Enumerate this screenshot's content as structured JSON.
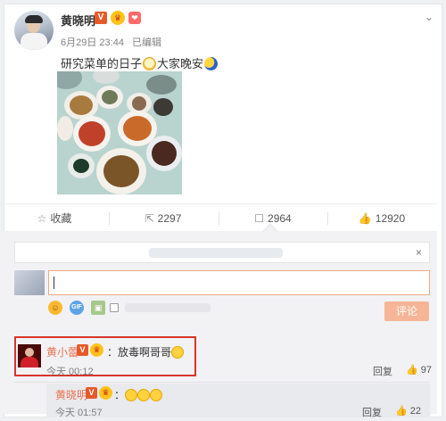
{
  "post": {
    "author": "黄晓明",
    "verified_badge": "V",
    "date": "6月29日 23:44",
    "edited": "已编辑",
    "text_before_emoji": "研究菜单的日子",
    "text_after_emoji": "大家晚安",
    "menu_icon": "chevron-down-icon"
  },
  "actions": {
    "favorite_label": "收藏",
    "repost_count": "2297",
    "comment_count": "2964",
    "like_count": "12920"
  },
  "composer": {
    "submit_label": "评论",
    "close_label": "×",
    "tools": [
      "smile-icon",
      "gif-icon",
      "image-icon",
      "checkbox"
    ]
  },
  "comments": [
    {
      "name": "黄小蕾",
      "badge": "V",
      "text": "：放毒啊哥哥",
      "time": "今天 00:12",
      "reply_label": "回复",
      "likes": "97"
    },
    {
      "name": "黄晓明",
      "badge": "V",
      "text": "：",
      "time": "今天 01:57",
      "reply_label": "回复",
      "likes": "22"
    }
  ],
  "colors": {
    "accent": "#eb7350",
    "highlight_border": "#d8352a",
    "submit_bg": "#f6b596",
    "panel_bg": "#f2f2f5"
  }
}
